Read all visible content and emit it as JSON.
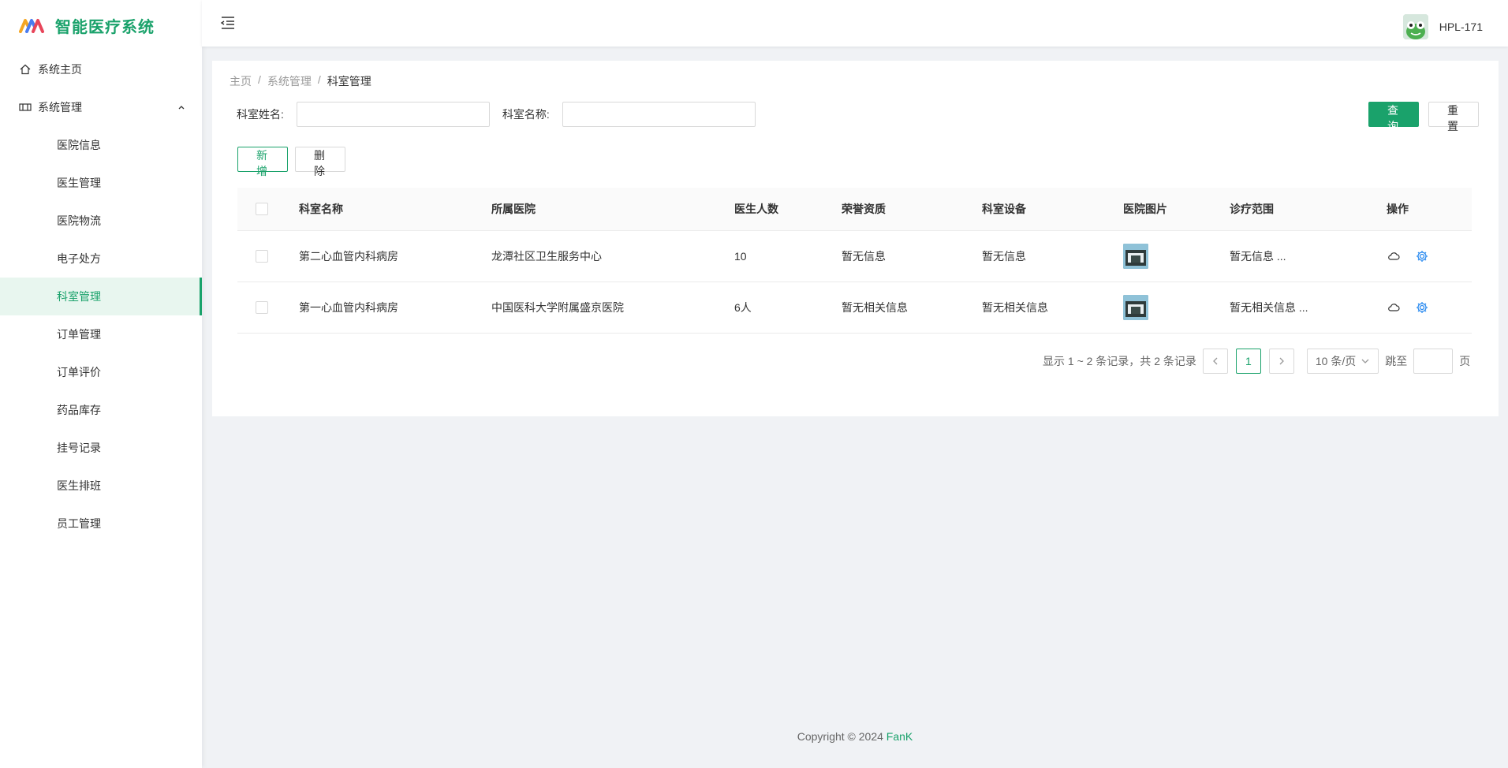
{
  "app": {
    "title": "智能医疗系统",
    "user_name": "HPL-171",
    "brand_color": "#1aa26b"
  },
  "sidebar": {
    "items": [
      {
        "label": "系统主页",
        "icon": "home-icon"
      },
      {
        "label": "系统管理",
        "icon": "manage-icon",
        "expanded": true
      }
    ],
    "subitems": [
      {
        "label": "医院信息"
      },
      {
        "label": "医生管理"
      },
      {
        "label": "医院物流"
      },
      {
        "label": "电子处方"
      },
      {
        "label": "科室管理",
        "active": true
      },
      {
        "label": "订单管理"
      },
      {
        "label": "订单评价"
      },
      {
        "label": "药品库存"
      },
      {
        "label": "挂号记录"
      },
      {
        "label": "医生排班"
      },
      {
        "label": "员工管理"
      }
    ]
  },
  "breadcrumb": {
    "home": "主页",
    "sep": "/",
    "parent": "系统管理",
    "current": "科室管理"
  },
  "search": {
    "field1_label": "科室姓名:",
    "field1_value": "",
    "field2_label": "科室名称:",
    "field2_value": "",
    "query_label": "查 询",
    "reset_label": "重 置"
  },
  "toolbar": {
    "add_label": "新 增",
    "delete_label": "删 除"
  },
  "table": {
    "headers": [
      "科室名称",
      "所属医院",
      "医生人数",
      "荣誉资质",
      "科室设备",
      "医院图片",
      "诊疗范围",
      "操作"
    ],
    "rows": [
      {
        "name": "第二心血管内科病房",
        "hospital": "龙潭社区卫生服务中心",
        "doctors": "10",
        "honor": "暂无信息",
        "equipment": "暂无信息",
        "scope": "暂无信息 ..."
      },
      {
        "name": "第一心血管内科病房",
        "hospital": "中国医科大学附属盛京医院",
        "doctors": "6人",
        "honor": "暂无相关信息",
        "equipment": "暂无相关信息",
        "scope": "暂无相关信息 ..."
      }
    ]
  },
  "pagination": {
    "total_text": "显示 1 ~ 2 条记录，共 2 条记录",
    "current_page": "1",
    "page_size": "10 条/页",
    "jump_label": "跳至",
    "page_suffix": "页"
  },
  "footer": {
    "copyright": "Copyright © 2024",
    "author": "FanK"
  }
}
